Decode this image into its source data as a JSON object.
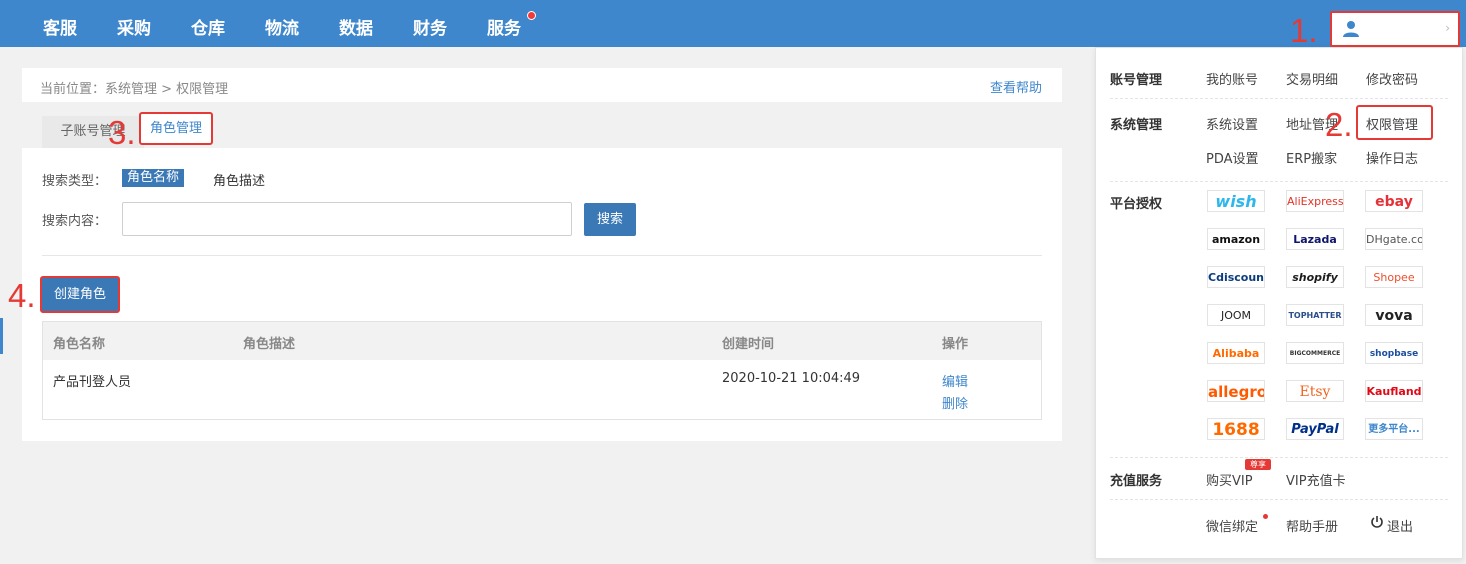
{
  "nav": {
    "items": [
      "客服",
      "采购",
      "仓库",
      "物流",
      "数据",
      "财务",
      "服务"
    ]
  },
  "annotations": {
    "a1": "1.",
    "a2": "2.",
    "a3": "3.",
    "a4": "4."
  },
  "breadcrumb": {
    "prefix": "当前位置：",
    "path": "系统管理 > 权限管理"
  },
  "help_link": "查看帮助",
  "tabs": [
    "子账号管理",
    "角色管理"
  ],
  "search": {
    "type_label": "搜索类型：",
    "type_selected": "角色名称",
    "type_other": "角色描述",
    "content_label": "搜索内容：",
    "value": "",
    "button": "搜索"
  },
  "create_button": "创建角色",
  "table": {
    "headers": [
      "角色名称",
      "角色描述",
      "创建时间",
      "操作"
    ],
    "rows": [
      {
        "name": "产品刊登人员",
        "desc": "",
        "created": "2020-10-21 10:04:49",
        "actions": [
          "编辑",
          "删除"
        ]
      }
    ]
  },
  "menu": {
    "account": {
      "title": "账号管理",
      "items": [
        "我的账号",
        "交易明细",
        "修改密码"
      ]
    },
    "system": {
      "title": "系统管理",
      "items": [
        "系统设置",
        "地址管理",
        "权限管理",
        "PDA设置",
        "ERP搬家",
        "操作日志"
      ]
    },
    "platform": {
      "title": "平台授权",
      "logos": [
        "wish",
        "AliExpress",
        "ebay",
        "amazon",
        "Lazada",
        "DHgate.com",
        "Cdiscount",
        "shopify",
        "Shopee",
        "JOOM",
        "TOPHATTER",
        "vova",
        "Alibaba",
        "BIGCOMMERCE",
        "shopbase",
        "allegro",
        "Etsy",
        "Kaufland",
        "1688",
        "PayPal",
        "更多平台..."
      ]
    },
    "recharge": {
      "title": "充值服务",
      "items": [
        "购买VIP",
        "VIP充值卡"
      ],
      "badge": "尊享"
    },
    "footer": [
      "微信绑定",
      "帮助手册",
      "退出"
    ]
  },
  "colors": {
    "primary": "#3f87cc",
    "button": "#3a78b6",
    "annotation": "#e53935"
  }
}
